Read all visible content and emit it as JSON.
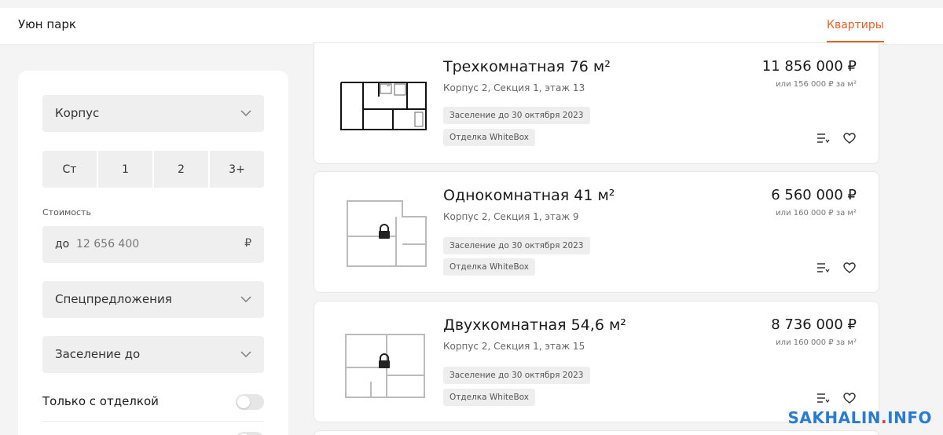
{
  "header": {
    "brand": "Уюн парк",
    "nav_tab": "Квартиры",
    "accent": "#e2622b"
  },
  "filters": {
    "korpus_label": "Корпус",
    "rooms": [
      "Ст",
      "1",
      "2",
      "3+"
    ],
    "price_caption": "Стоимость",
    "price_prefix": "до",
    "price_value": "12 656 400",
    "price_currency": "₽",
    "special_label": "Спецпредложения",
    "settle_label": "Заселение до",
    "finish_toggle_label": "Только с отделкой"
  },
  "listings": [
    {
      "title": "Трехкомнатная 76 м²",
      "sub": "Корпус 2, Секция 1, этаж 13",
      "tag_settle": "Заселение до 30 октября 2023",
      "tag_finish": "Отделка WhiteBox",
      "price": "11 856 000 ₽",
      "ppm": "или 156 000 ₽ за м²",
      "locked": false
    },
    {
      "title": "Однокомнатная 41 м²",
      "sub": "Корпус 2, Секция 1, этаж 9",
      "tag_settle": "Заселение до 30 октября 2023",
      "tag_finish": "Отделка WhiteBox",
      "price": "6 560 000 ₽",
      "ppm": "или 160 000 ₽ за м²",
      "locked": true
    },
    {
      "title": "Двухкомнатная 54,6 м²",
      "sub": "Корпус 2, Секция 1, этаж 15",
      "tag_settle": "Заселение до 30 октября 2023",
      "tag_finish": "Отделка WhiteBox",
      "price": "8 736 000 ₽",
      "ppm": "или 160 000 ₽ за м²",
      "locked": true
    }
  ],
  "icons": {
    "compare": "compare-list-icon",
    "favorite": "heart-icon",
    "lock": "lock-icon",
    "chevron": "chevron-down-icon"
  },
  "watermark": {
    "main": "SAKHALIN",
    "dot": ".",
    "tld": "INFO"
  }
}
